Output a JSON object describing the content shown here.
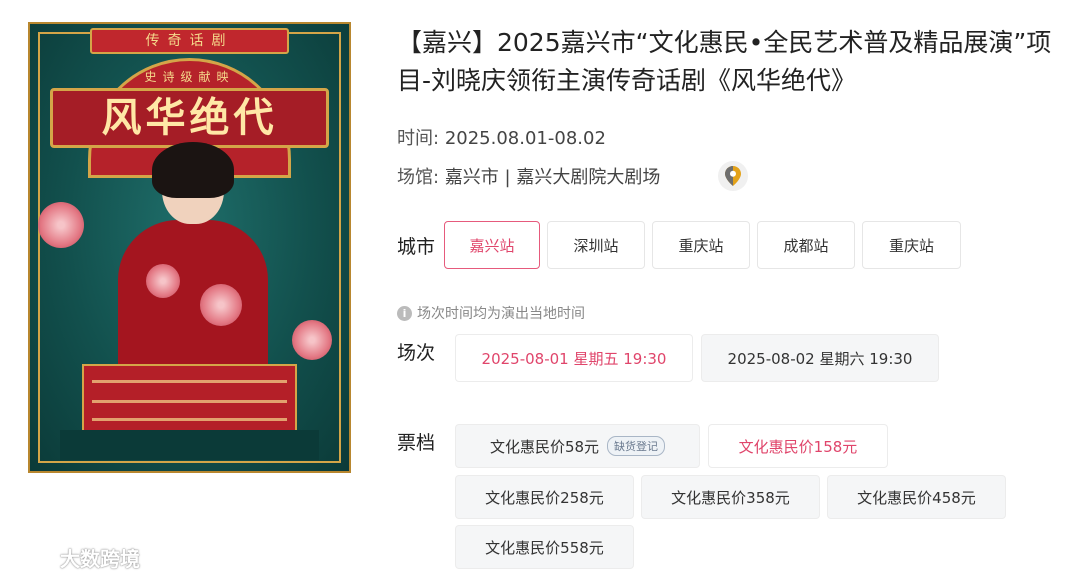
{
  "event": {
    "title": "【嘉兴】2025嘉兴市“文化惠民•全民艺术普及精品展演”项目-刘晓庆领衔主演传奇话剧《风华绝代》",
    "time_label": "时间:",
    "time_value": "2025.08.01-08.02",
    "venue_label": "场馆:",
    "venue_value": "嘉兴市 | 嘉兴大剧院大剧场"
  },
  "poster": {
    "band": "传奇话剧",
    "subtitle": "史诗级献映",
    "title": "风华绝代"
  },
  "city": {
    "label": "城市",
    "options": [
      "嘉兴站",
      "深圳站",
      "重庆站",
      "成都站",
      "重庆站"
    ],
    "selected": 0
  },
  "notice": "场次时间均为演出当地时间",
  "session": {
    "label": "场次",
    "options": [
      "2025-08-01 星期五 19:30",
      "2025-08-02 星期六 19:30"
    ],
    "selected": 0
  },
  "ticket": {
    "label": "票档",
    "options": [
      "文化惠民价58元",
      "文化惠民价158元",
      "文化惠民价258元",
      "文化惠民价358元",
      "文化惠民价458元",
      "文化惠民价558元"
    ],
    "badge": "缺货登记",
    "selected": 1
  },
  "watermark": "大数跨境",
  "colors": {
    "accent": "#e0456b",
    "poster_teal": "#12504d",
    "poster_red": "#b41f28",
    "poster_gold": "#d4a548"
  }
}
